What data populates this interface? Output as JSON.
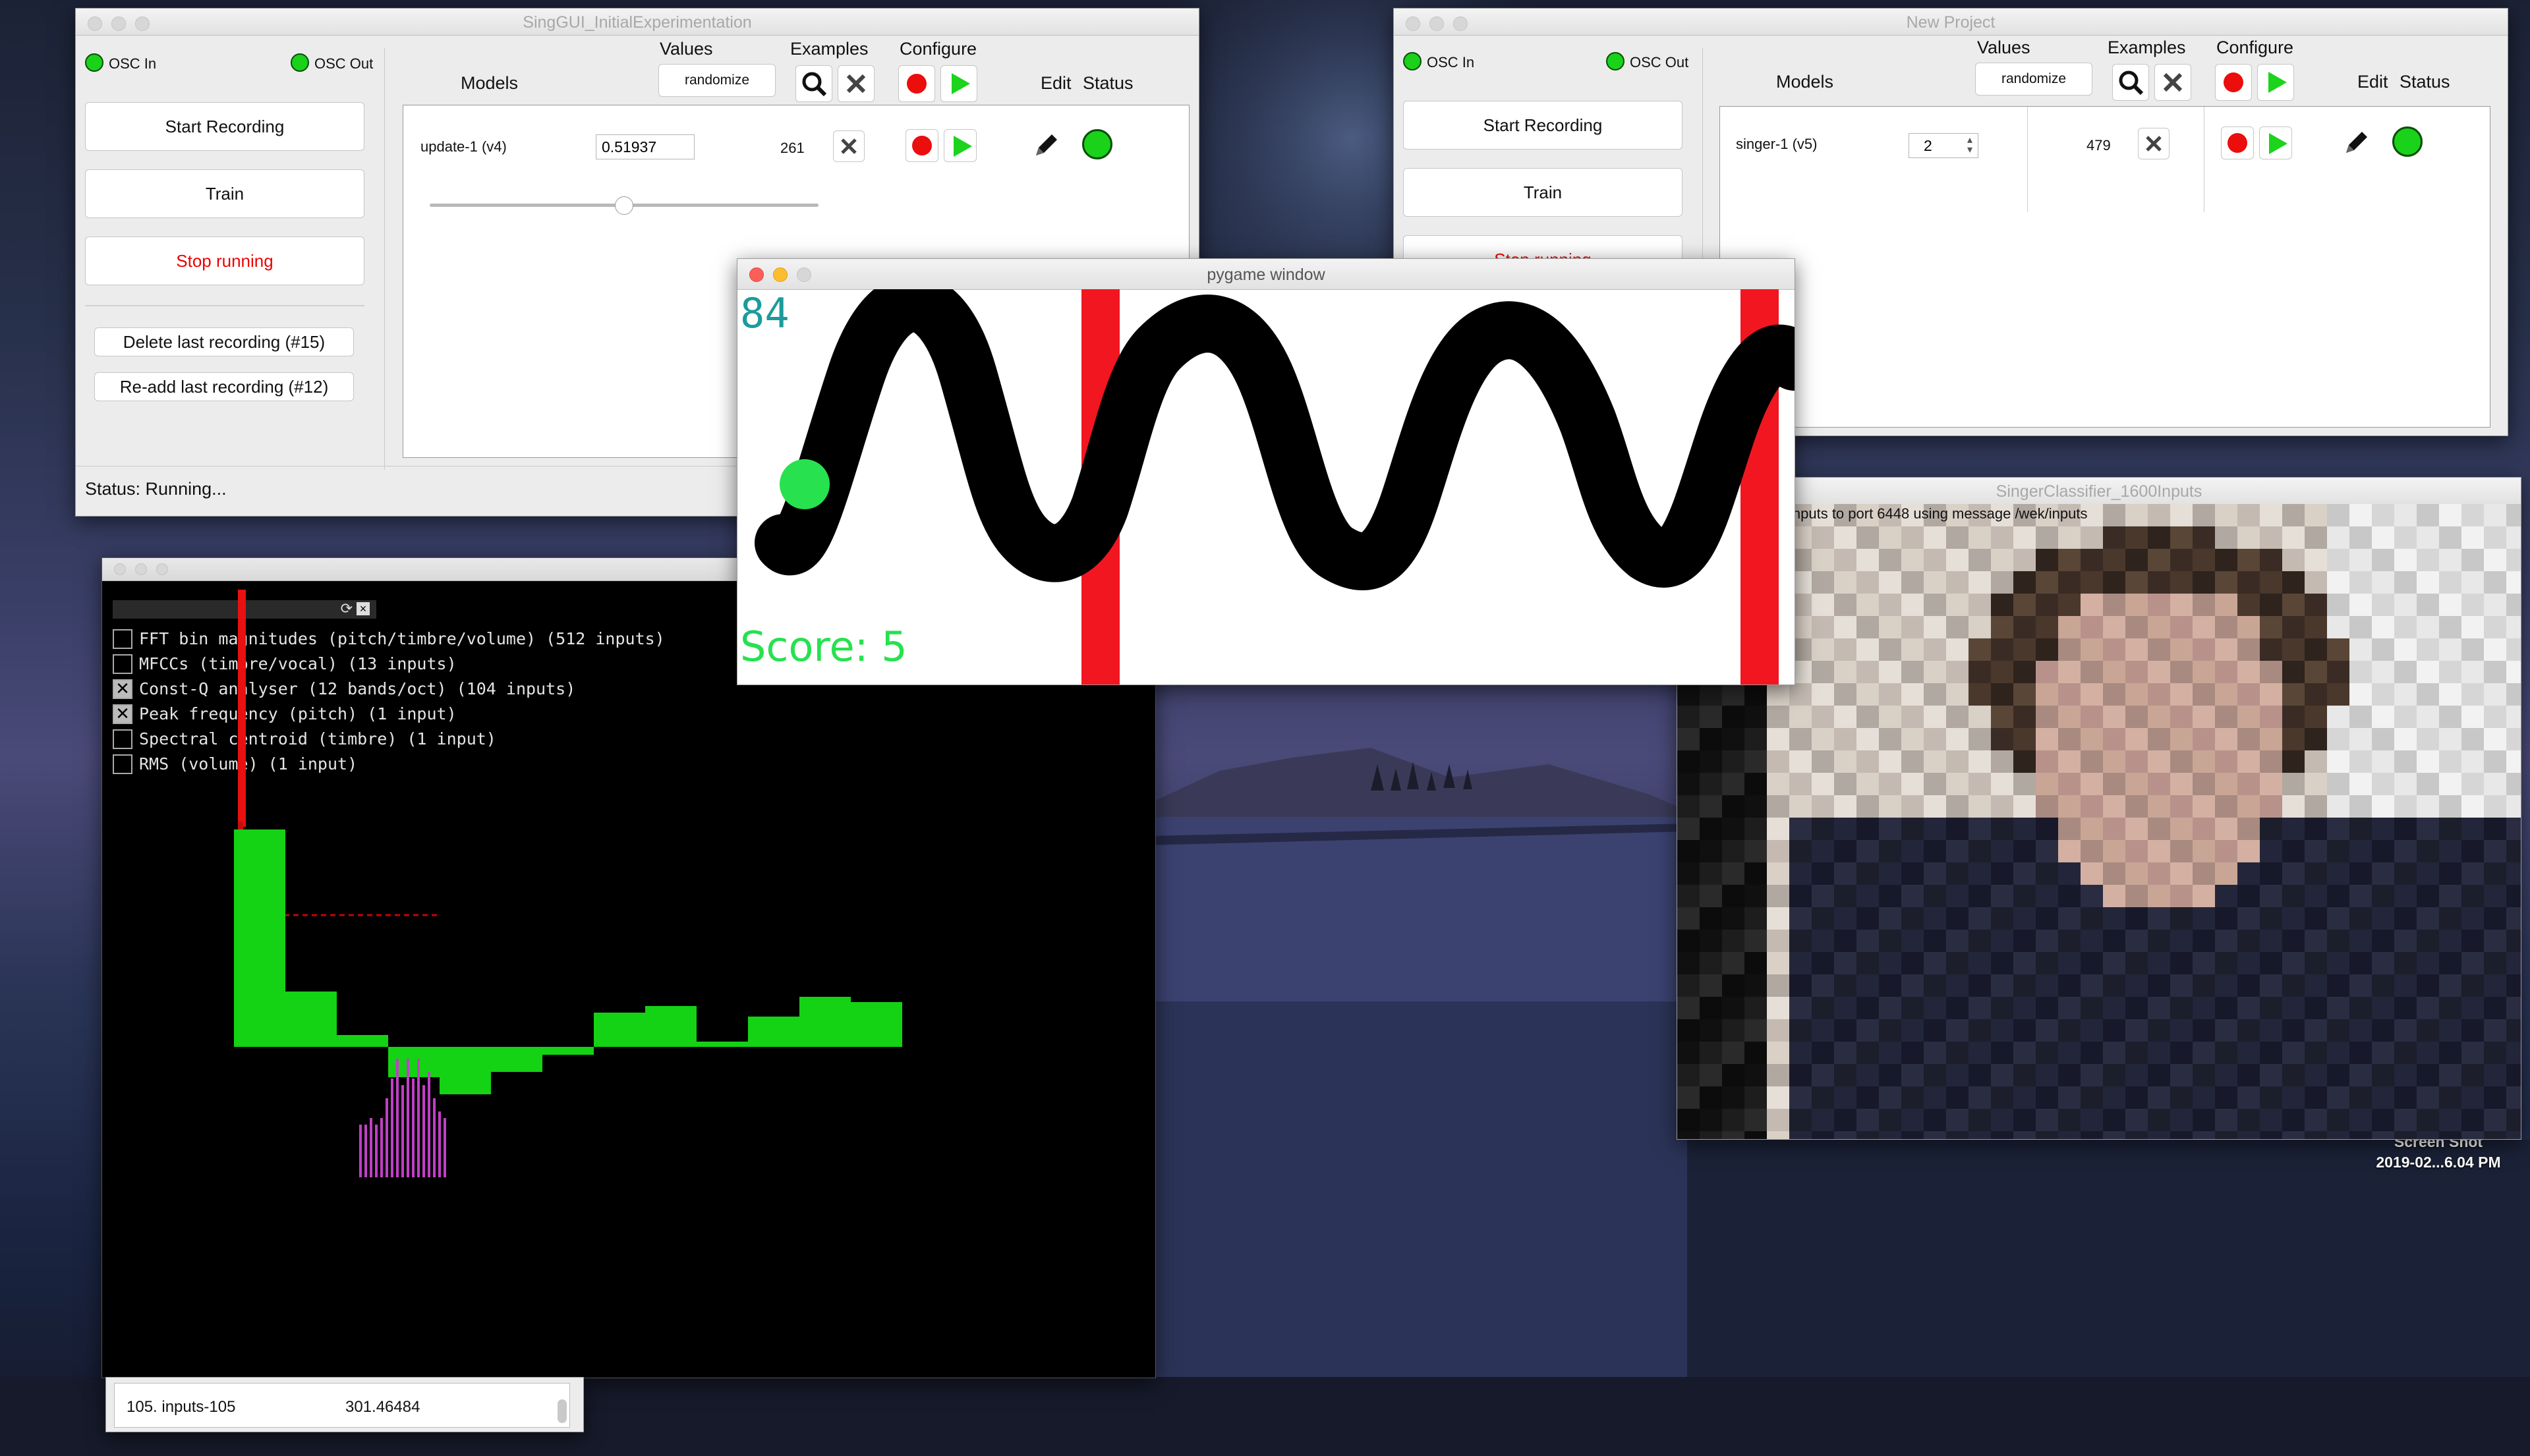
{
  "desktop": {
    "screenshot_label_line1": "Screen Shot",
    "screenshot_label_line2": "2019-02...6.04 PM"
  },
  "win1": {
    "title": "SingGUI_InitialExperimentation",
    "osc_in": "OSC In",
    "osc_out": "OSC Out",
    "start_recording": "Start Recording",
    "train": "Train",
    "stop_running": "Stop running",
    "delete_last": "Delete last recording (#15)",
    "readd_last": "Re-add last recording (#12)",
    "status": "Status: Running...",
    "headers": {
      "models": "Models",
      "values": "Values",
      "examples": "Examples",
      "configure": "Configure",
      "edit": "Edit",
      "status": "Status"
    },
    "randomize": "randomize",
    "model": {
      "name": "update-1 (v4)",
      "value": "0.51937",
      "examples": "261",
      "slider_fraction": 0.5
    }
  },
  "win2": {
    "title": "New Project",
    "osc_in": "OSC In",
    "osc_out": "OSC Out",
    "start_recording": "Start Recording",
    "train": "Train",
    "stop_running": "Stop running",
    "headers": {
      "models": "Models",
      "values": "Values",
      "examples": "Examples",
      "configure": "Configure",
      "edit": "Edit",
      "status": "Status"
    },
    "randomize": "randomize",
    "model": {
      "name": "singer-1 (v5)",
      "value": "2",
      "examples": "479"
    }
  },
  "pygame": {
    "title": "pygame window",
    "counter": "84",
    "score": "Score: 5"
  },
  "extractor": {
    "features": [
      {
        "label": "FFT bin magnitudes (pitch/timbre/volume) (512 inputs)",
        "checked": false
      },
      {
        "label": "MFCCs (timbre/vocal) (13 inputs)",
        "checked": false
      },
      {
        "label": "Const-Q analyser (12 bands/oct) (104 inputs)",
        "checked": true
      },
      {
        "label": "Peak frequency (pitch) (1 input)",
        "checked": true
      },
      {
        "label": "Spectral centroid (timbre) (1 input)",
        "checked": false
      },
      {
        "label": "RMS (volume) (1 input)",
        "checked": false
      }
    ],
    "list_row": {
      "name": "105. inputs-105",
      "value": "301.46484"
    }
  },
  "classifier": {
    "title": "SingerClassifier_1600Inputs",
    "overlay": "inputs to port 6448 using message /wek/inputs"
  },
  "colors": {
    "accent_green": "#19d219",
    "record_red": "#ec0d0d",
    "pygame_score": "#27e14f",
    "pygame_counter": "#1b9b9b",
    "bar_green": "#14d214",
    "bar_magenta": "#c13fc6"
  }
}
